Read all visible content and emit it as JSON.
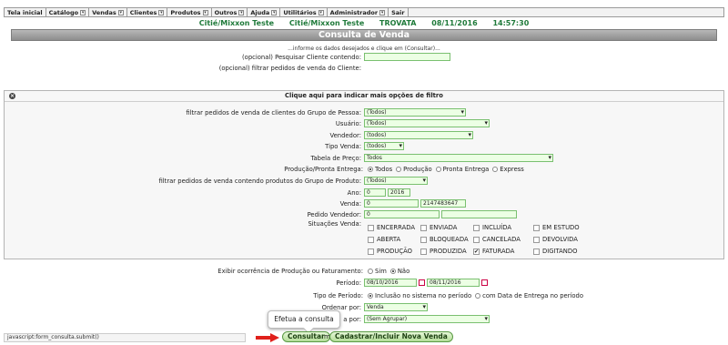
{
  "menu": [
    {
      "label": "Tela inicial",
      "dropdown": false
    },
    {
      "label": "Catálogo",
      "dropdown": true
    },
    {
      "label": "Vendas",
      "dropdown": true
    },
    {
      "label": "Clientes",
      "dropdown": true
    },
    {
      "label": "Produtos",
      "dropdown": true
    },
    {
      "label": "Outros",
      "dropdown": true
    },
    {
      "label": "Ajuda",
      "dropdown": true
    },
    {
      "label": "Utilitários",
      "dropdown": true
    },
    {
      "label": "Administrador",
      "dropdown": true
    },
    {
      "label": "Sair",
      "dropdown": false
    }
  ],
  "status": {
    "company": "Citié/Mixxon Teste",
    "company2": "Citié/Mixxon Teste",
    "user": "TROVATA",
    "date": "08/11/2016",
    "time": "14:57:30",
    "color": "#1f7a3a"
  },
  "page": {
    "title": "Consulta de Venda",
    "info": "...informe os dados desejados e clique em (Consultar)..."
  },
  "search": {
    "client_label": "(opcional) Pesquisar Cliente contendo:",
    "client_value": "",
    "filter_label": "(opcional) filtrar pedidos de venda do Cliente:"
  },
  "options": {
    "header": "Clique aqui para indicar mais opções de filtro",
    "grupo_pessoa_label": "filtrar pedidos de venda de clientes do Grupo de Pessoa:",
    "grupo_pessoa_value": "(Todos)",
    "usuario_label": "Usuário:",
    "usuario_value": "(Todos)",
    "vendedor_label": "Vendedor:",
    "vendedor_value": "(todos)",
    "tipo_venda_label": "Tipo Venda:",
    "tipo_venda_value": "(todos)",
    "tabela_preco_label": "Tabela de Preço:",
    "tabela_preco_value": "Todos",
    "producao_label": "Produção/Pronta Entrega:",
    "producao_options": [
      "Todos",
      "Produção",
      "Pronta Entrega",
      "Express"
    ],
    "grupo_produto_label": "filtrar pedidos de venda contendo produtos do Grupo de Produto:",
    "grupo_produto_value": "(Todos)",
    "ano_label": "Ano:",
    "ano_from": "0",
    "ano_to": "2016",
    "venda_label": "Venda:",
    "venda_from": "0",
    "venda_to": "2147483647",
    "pedido_vendedor_label": "Pedido Vendedor:",
    "pedido_vendedor_from": "0",
    "pedido_vendedor_to": "",
    "situacoes_label": "Situações Venda:",
    "situacoes": [
      {
        "label": "ENCERRADA",
        "checked": false
      },
      {
        "label": "ENVIADA",
        "checked": false
      },
      {
        "label": "INCLUÍDA",
        "checked": false
      },
      {
        "label": "EM ESTUDO",
        "checked": false
      },
      {
        "label": "ABERTA",
        "checked": false
      },
      {
        "label": "BLOQUEADA",
        "checked": false
      },
      {
        "label": "CANCELADA",
        "checked": false
      },
      {
        "label": "DEVOLVIDA",
        "checked": false
      },
      {
        "label": "PRODUÇÃO",
        "checked": false
      },
      {
        "label": "PRODUZIDA",
        "checked": false
      },
      {
        "label": "FATURADA",
        "checked": true
      },
      {
        "label": "DIGITANDO",
        "checked": false
      }
    ]
  },
  "bottom": {
    "ocorrencia_label": "Exibir ocorrência de Produção ou Faturamento:",
    "ocorrencia_sim": "Sim",
    "ocorrencia_nao": "Não",
    "periodo_label": "Período:",
    "periodo_from": "08/10/2016",
    "periodo_to": "08/11/2016",
    "tipo_periodo_label": "Tipo de Período:",
    "tipo_periodo_opt1": "Inclusão no sistema no período",
    "tipo_periodo_opt2": "com Data de Entrega no período",
    "ordenar_label": "Ordenar por:",
    "ordenar_value": "Venda",
    "agrupar_label_partial": "a por:",
    "agrupar_value": "(Sem Agrupar)"
  },
  "buttons": {
    "consultar": "Consultar",
    "cadastrar": "Cadastrar/Incluir Nova Venda",
    "partial": "m"
  },
  "tooltip": "Efetua a consulta",
  "browser_status": "javascript:form_consulta.submit()"
}
